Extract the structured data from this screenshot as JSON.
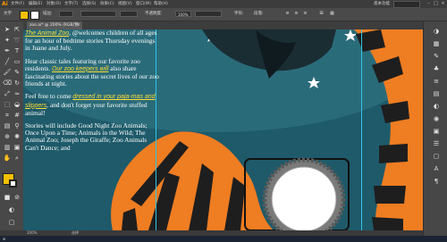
{
  "app": {
    "logo": "Ai"
  },
  "menu": {
    "items": [
      "文件(F)",
      "编辑(E)",
      "对象(O)",
      "文字(T)",
      "选择(S)",
      "效果(C)",
      "视图(V)",
      "窗口(W)",
      "帮助(H)"
    ],
    "workspace": "基本功能",
    "window_controls": [
      "–",
      "□",
      "×"
    ]
  },
  "control_bar": {
    "mode_label": "文字",
    "stroke_label": "描边:",
    "opacity_label": "不透明度:",
    "opacity_value": "100%",
    "char_label": "字符:",
    "para_label": "段落:"
  },
  "document_tab": {
    "title": "zoo.ai* @ 200% (RGB/预览)",
    "close": "×"
  },
  "text_frame": {
    "p1_link": "The Animal Zoo",
    "p1_rest": ", @welcomes children of all ages for an hour of bedtime stories Thursday evenings in Juane and July.",
    "p2_start": "Hear classic tales featuring our favorite zoo residents. ",
    "p2_link": "Our zoo keepers will",
    "p2_rest": " also share fascinating stories about the secret lives of our zoo friends at night.",
    "p3_start": "Feel free to come ",
    "p3_link": "dressed in your paja-mas and slippers",
    "p3_rest": ", and don't forget your favorite stuffed animal!",
    "p4": "Stories will include Good Night Zoo Animals; Once Upon a Time; Animals in the Wild; The Animal Zoo; Joseph the Giraffe; Zoo Animals Can't Dance; and"
  },
  "status_bar": {
    "zoom": "200%",
    "tool": "选择"
  },
  "colors": {
    "tiger_orange": "#ef7d22",
    "tiger_stripe": "#1e1e1e",
    "sky_teal": "#1e5a6a",
    "fill_yellow": "#f5c000",
    "link_yellow": "#ffdd33",
    "guide_cyan": "#2ec6e6"
  }
}
